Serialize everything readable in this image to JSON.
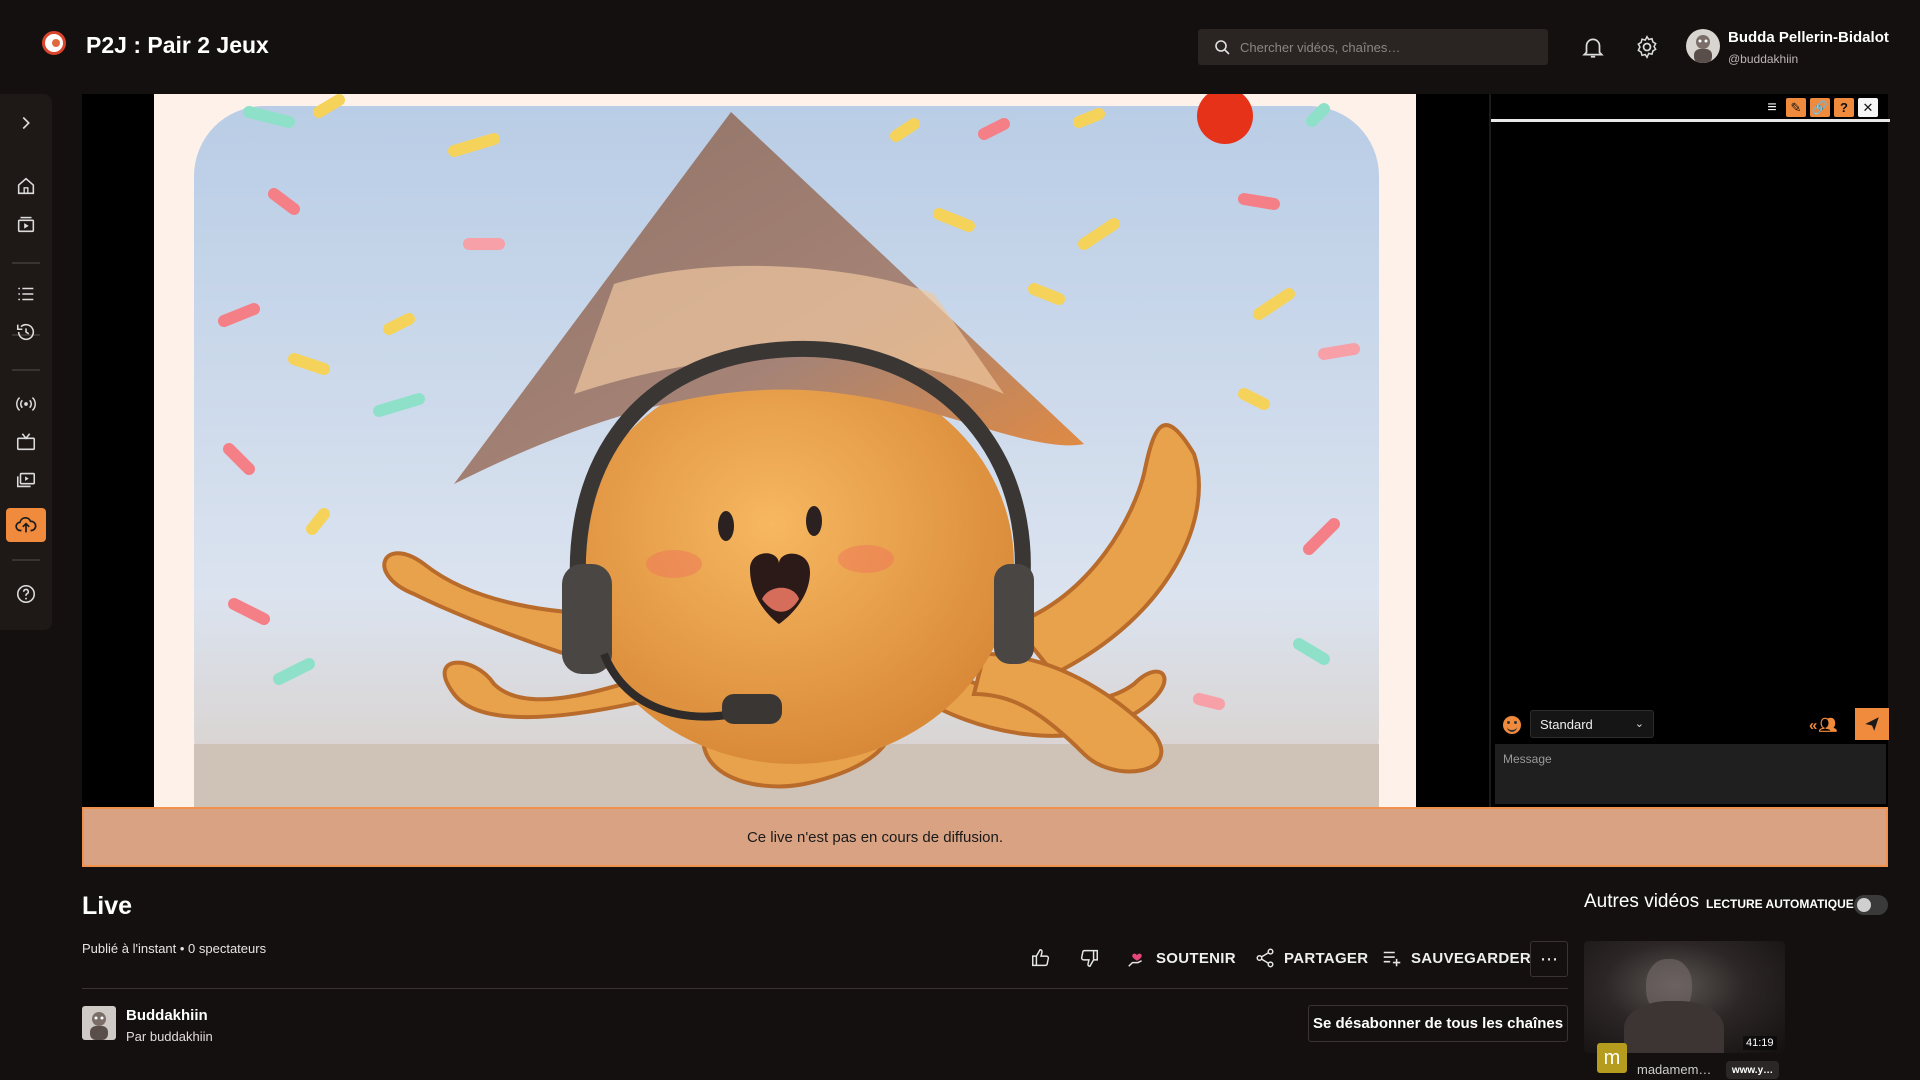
{
  "header": {
    "title": "P2J : Pair 2 Jeux",
    "search_placeholder": "Chercher vidéos, chaînes…",
    "user_name": "Budda Pellerin-Bidalot",
    "user_handle": "@buddakhiin"
  },
  "sidebar": {
    "icons": [
      "chevron-right-icon",
      "home-icon",
      "subscriptions-icon",
      "playlist-icon",
      "history-icon",
      "live-icon",
      "tv-icon",
      "channels-icon",
      "upload-icon",
      "help-icon"
    ],
    "active": "upload-icon",
    "accent": "#f08a3c"
  },
  "chat": {
    "mode": "Standard",
    "input_placeholder": "Message",
    "tools": [
      "≡",
      "✎",
      "🔗",
      "?",
      "✕"
    ]
  },
  "banner": {
    "text": "Ce live n'est pas en cours de diffusion."
  },
  "video": {
    "title": "Live",
    "meta": "Publié à l'instant • 0 spectateurs",
    "actions": {
      "support": "SOUTENIR",
      "share": "PARTAGER",
      "save": "SAUVEGARDER"
    },
    "channel_name": "Buddakhiin",
    "channel_by": "Par buddakhiin",
    "unsubscribe_label": "Se désabonner de tous les chaînes"
  },
  "sidebar_videos": {
    "title": "Autres vidéos",
    "autoplay_label": "LECTURE AUTOMATIQUE",
    "autoplay_on": false,
    "items": [
      {
        "duration": "41:19",
        "avatar_letter": "m",
        "author": "madamem…",
        "link": "www.y…"
      }
    ]
  }
}
